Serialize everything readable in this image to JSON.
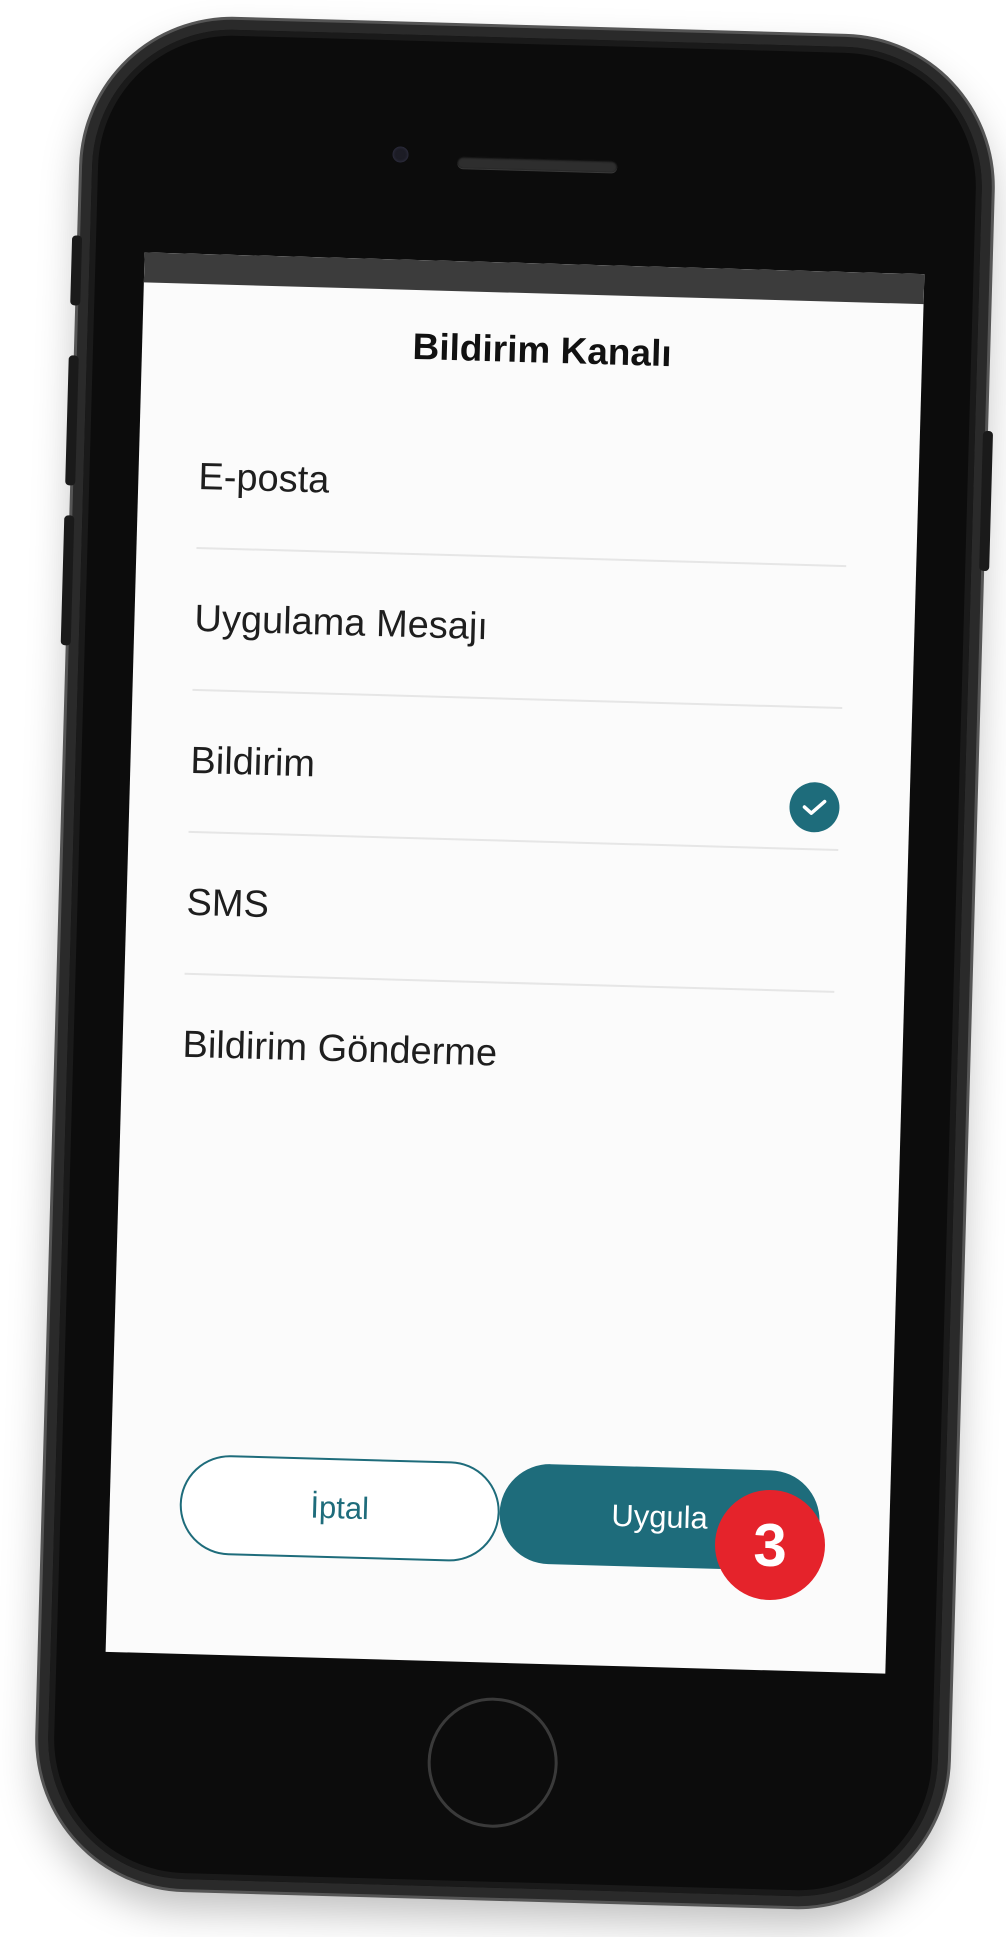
{
  "sheet": {
    "title": "Bildirim Kanalı",
    "options": [
      {
        "label": "E-posta",
        "selected": false
      },
      {
        "label": "Uygulama Mesajı",
        "selected": false
      },
      {
        "label": "Bildirim",
        "selected": true
      },
      {
        "label": "SMS",
        "selected": false
      },
      {
        "label": "Bildirim Gönderme",
        "selected": false
      }
    ],
    "cancel_label": "İptal",
    "apply_label": "Uygula"
  },
  "annotation": {
    "step_number": "3"
  },
  "colors": {
    "accent": "#1e6c7b",
    "badge": "#e5232b"
  },
  "icons": {
    "selected": "check-circle-icon"
  }
}
